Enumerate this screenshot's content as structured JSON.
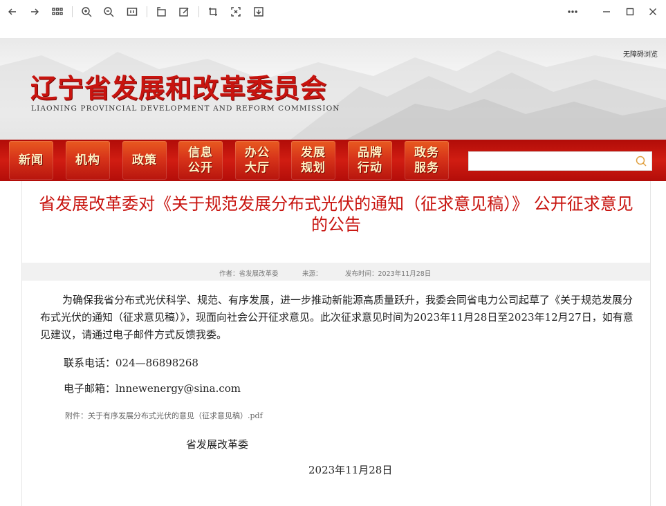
{
  "toolbar": {
    "icons": [
      "back-icon",
      "forward-icon",
      "thumbnails-icon",
      "zoom-in-icon",
      "zoom-out-icon",
      "fit-icon",
      "rotate-icon",
      "edit-icon",
      "screenshot-icon",
      "fullscreen-icon",
      "download-icon",
      "more-icon",
      "minimize-icon",
      "maximize-icon",
      "close-icon"
    ]
  },
  "header": {
    "title": "辽宁省发展和改革委员会",
    "subtitle": "LIAONING PROVINCIAL DEVELOPMENT AND REFORM COMMISSION",
    "accessibility": "无障碍浏览"
  },
  "nav": {
    "items": [
      {
        "label": "新闻"
      },
      {
        "label": "机构"
      },
      {
        "label": "政策"
      },
      {
        "label": "信息\n公开"
      },
      {
        "label": "办公\n大厅"
      },
      {
        "label": "发展\n规划"
      },
      {
        "label": "品牌\n行动"
      },
      {
        "label": "政务\n服务"
      }
    ],
    "search_placeholder": ""
  },
  "article": {
    "title": "省发展改革委对《关于规范发展分布式光伏的通知（征求意见稿）》 公开征求意见的公告",
    "meta": {
      "author": "作者：省发展改革委",
      "source": "来源：",
      "date": "发布时间：2023年11月28日"
    },
    "body": "为确保我省分布式光伏科学、规范、有序发展，进一步推动新能源高质量跃升，我委会同省电力公司起草了《关于规范发展分布式光伏的通知（征求意见稿）》，现面向社会公开征求意见。此次征求意见时间为2023年11月28日至2023年12月27日，如有意见建议，请通过电子邮件方式反馈我委。",
    "phone": "联系电话：024—86898268",
    "email": "电子邮箱：lnnewenergy@sina.com",
    "attachment": "附件：关于有序发展分布式光伏的意见（征求意见稿）.pdf",
    "signature": "省发展改革委",
    "sign_date": "2023年11月28日"
  },
  "colors": {
    "brand_red": "#c8140f",
    "nav_bar": "#c01410",
    "nav_button": "#d7341a",
    "nav_text": "#fff3c4"
  }
}
